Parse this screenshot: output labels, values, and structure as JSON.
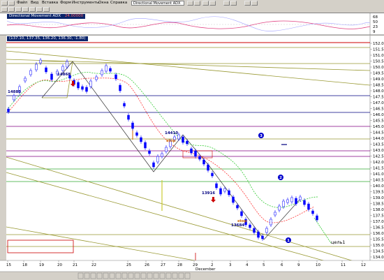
{
  "toolbar": {
    "menu_labels": [
      "Файл",
      "Вид",
      "Вставка",
      "Форм",
      "Инструменты",
      "Окна",
      "Справка"
    ],
    "indicator_select": "Directional Movement ADX"
  },
  "indicator_panel": {
    "title": "Directional Movement ADX",
    "value": "24.00000",
    "scale": [
      "68",
      "50",
      "23",
      "9"
    ]
  },
  "price_panel": {
    "header": "(137.10, 137.35, 136.20, 136.30, -1.80)",
    "right_scale": [
      "152.0",
      "151.5",
      "151.0",
      "150.5",
      "150.0",
      "149.5",
      "149.0",
      "148.5",
      "148.0",
      "147.5",
      "147.0",
      "146.5",
      "146.0",
      "145.5",
      "145.0",
      "144.5",
      "144.0",
      "143.5",
      "143.0",
      "142.5",
      "142.0",
      "141.5",
      "141.0",
      "140.5",
      "140.0",
      "139.5",
      "139.0",
      "138.5",
      "138.0",
      "137.5",
      "137.0",
      "136.5",
      "136.0",
      "135.5",
      "135.0",
      "134.5",
      "134.0",
      "133.5"
    ],
    "date_ticks": [
      "15",
      "18",
      "19",
      "20",
      "21",
      "22",
      "25",
      "26",
      "27",
      "28",
      "29",
      "2",
      "3",
      "4",
      "5",
      "6",
      "9",
      "10",
      "11",
      "12"
    ],
    "month_label": "December"
  },
  "annotations": {
    "l1": "14885",
    "l2": "14868",
    "l3": "14410",
    "l4": "stop",
    "l5": "13916",
    "l6": "13684",
    "l7": "stop",
    "l8": "цель1",
    "n1": "1",
    "n2": "2",
    "n3": "3"
  },
  "colors": {
    "up_candle": "#0000ff",
    "sma_red": "#ff3333",
    "sma_green": "#33cc33",
    "fib_olive": "#999933",
    "fib_purple": "#800080",
    "accent": "#0a246a"
  },
  "bottom_toolbar": {
    "icons": [
      "draw-line-icon",
      "text-icon",
      "cursor-icon",
      "zoom-icon"
    ]
  }
}
